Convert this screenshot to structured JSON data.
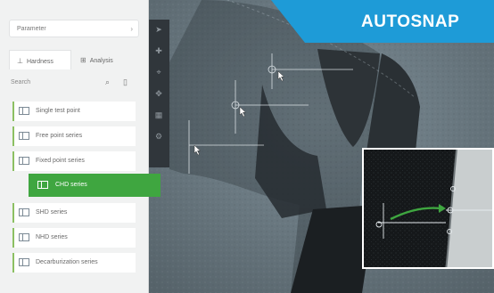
{
  "banner": {
    "label": "AUTOSNAP",
    "color": "#1e9bd7"
  },
  "panel": {
    "parameter_dropdown": "Parameter",
    "tabs": [
      {
        "label": "Hardness"
      },
      {
        "label": "Analysis"
      }
    ],
    "search_label": "Search",
    "methods": [
      {
        "label": "Single test point"
      },
      {
        "label": "Free point series"
      },
      {
        "label": "Fixed point series"
      },
      {
        "label": "CHD series"
      },
      {
        "label": "SHD series"
      },
      {
        "label": "NHD series"
      },
      {
        "label": "Decarburization series"
      }
    ]
  },
  "colors": {
    "accent_green": "#3fa640",
    "item_border": "#8cc063"
  }
}
